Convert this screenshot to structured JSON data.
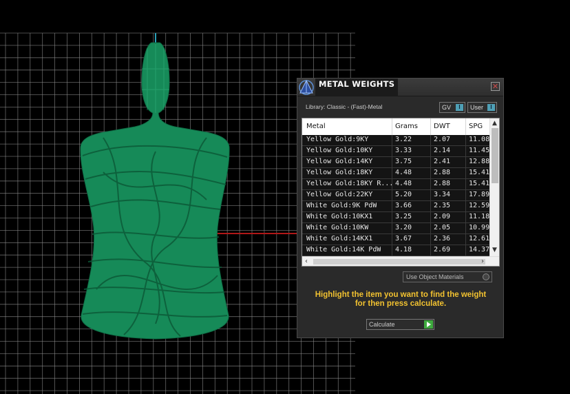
{
  "dialog": {
    "title": "METAL WEIGHTS",
    "close_symbol": "✕",
    "app_icon": "pyramid-logo-icon",
    "library": "Library: Classic - (Fast)-Metal",
    "gv_label": "GV",
    "gv_switch": "I",
    "user_label": "User",
    "user_switch": "I",
    "columns": [
      "Metal",
      "Grams",
      "DWT",
      "SPG"
    ],
    "rows": [
      {
        "metal": "Yellow Gold:9KY",
        "grams": "3.22",
        "dwt": "2.07",
        "spg": "11.08"
      },
      {
        "metal": "Yellow Gold:10KY",
        "grams": "3.33",
        "dwt": "2.14",
        "spg": "11.45"
      },
      {
        "metal": "Yellow Gold:14KY",
        "grams": "3.75",
        "dwt": "2.41",
        "spg": "12.88"
      },
      {
        "metal": "Yellow Gold:18KY",
        "grams": "4.48",
        "dwt": "2.88",
        "spg": "15.41"
      },
      {
        "metal": "Yellow Gold:18KY R...",
        "grams": "4.48",
        "dwt": "2.88",
        "spg": "15.41"
      },
      {
        "metal": "Yellow Gold:22KY",
        "grams": "5.20",
        "dwt": "3.34",
        "spg": "17.89"
      },
      {
        "metal": "White Gold:9K PdW",
        "grams": "3.66",
        "dwt": "2.35",
        "spg": "12.59"
      },
      {
        "metal": "White Gold:10KX1",
        "grams": "3.25",
        "dwt": "2.09",
        "spg": "11.18"
      },
      {
        "metal": "White Gold:10KW",
        "grams": "3.20",
        "dwt": "2.05",
        "spg": "10.99"
      },
      {
        "metal": "White Gold:14KX1",
        "grams": "3.67",
        "dwt": "2.36",
        "spg": "12.61"
      },
      {
        "metal": "White Gold:14K PdW",
        "grams": "4.18",
        "dwt": "2.69",
        "spg": "14.37"
      }
    ],
    "use_materials_label": "Use Object Materials",
    "hint_line1": "Highlight the item you want to find the weight",
    "hint_line2": "for then press calculate.",
    "calculate_label": "Calculate"
  },
  "colors": {
    "accent_hint": "#f2c230",
    "toggle_switch": "#4fa0b6",
    "calculate_go": "#3faa3f",
    "model_green": "#1a8a5a",
    "grid_line": "#8a8a8a",
    "axis_red": "#b01818"
  }
}
